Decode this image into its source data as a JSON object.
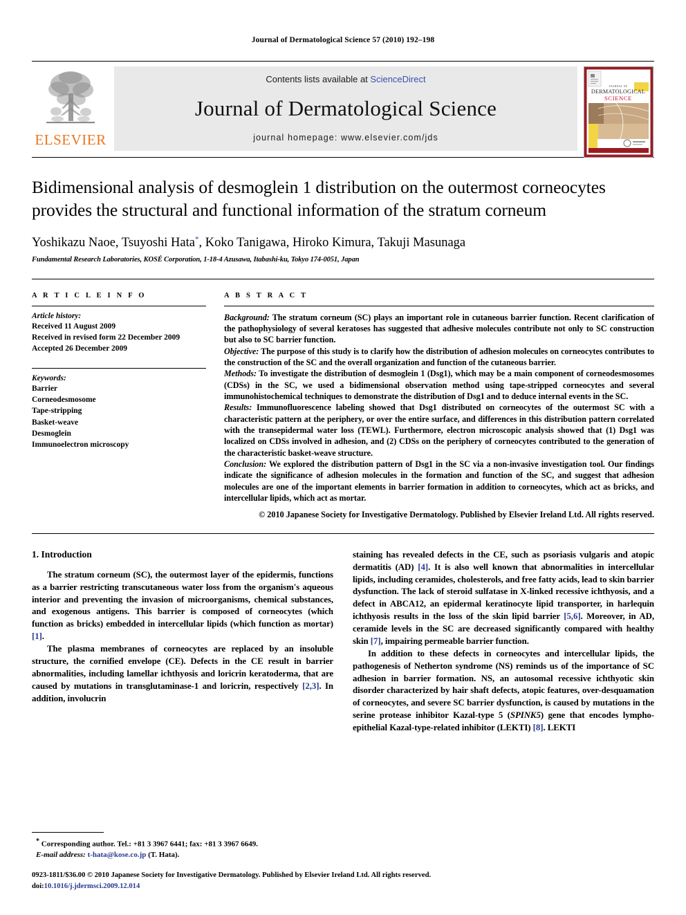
{
  "running_head": "Journal of Dermatological Science 57 (2010) 192–198",
  "masthead": {
    "logo_wordmark": "ELSEVIER",
    "contents_prefix": "Contents lists available at ",
    "sciencedirect": "ScienceDirect",
    "journal_title": "Journal of Dermatological Science",
    "homepage": "journal homepage: www.elsevier.com/jds",
    "cover": {
      "line1": "JOURNAL OF",
      "line2": "DERMATOLOGICAL",
      "line3": "SCIENCE",
      "border_color": "#9b1b23",
      "accent_color": "#c8102e",
      "band_yellow": "#f2d544",
      "skin_tone": "#c8a882"
    }
  },
  "article": {
    "title": "Bidimensional analysis of desmoglein 1 distribution on the outermost corneocytes provides the structural and functional information of the stratum corneum",
    "authors_pre": "Yoshikazu Naoe, Tsuyoshi Hata",
    "authors_star": "*",
    "authors_post": ", Koko Tanigawa, Hiroko Kimura, Takuji Masunaga",
    "affiliation": "Fundamental Research Laboratories, KOSÉ Corporation, 1-18-4 Azusawa, Itabashi-ku, Tokyo 174-0051, Japan"
  },
  "article_info": {
    "label": "A R T I C L E   I N F O",
    "history_head": "Article history:",
    "history": [
      "Received 11 August 2009",
      "Received in revised form 22 December 2009",
      "Accepted 26 December 2009"
    ],
    "keywords_head": "Keywords:",
    "keywords": [
      "Barrier",
      "Corneodesmosome",
      "Tape-stripping",
      "Basket-weave",
      "Desmoglein",
      "Immunoelectron microscopy"
    ]
  },
  "abstract": {
    "label": "A B S T R A C T",
    "sections": [
      {
        "lead": "Background:",
        "text": " The stratum corneum (SC) plays an important role in cutaneous barrier function. Recent clarification of the pathophysiology of several keratoses has suggested that adhesive molecules contribute not only to SC construction but also to SC barrier function."
      },
      {
        "lead": "Objective:",
        "text": " The purpose of this study is to clarify how the distribution of adhesion molecules on corneocytes contributes to the construction of the SC and the overall organization and function of the cutaneous barrier."
      },
      {
        "lead": "Methods:",
        "text": " To investigate the distribution of desmoglein 1 (Dsg1), which may be a main component of corneodesmosomes (CDSs) in the SC, we used a bidimensional observation method using tape-stripped corneocytes and several immunohistochemical techniques to demonstrate the distribution of Dsg1 and to deduce internal events in the SC."
      },
      {
        "lead": "Results:",
        "text": " Immunofluorescence labeling showed that Dsg1 distributed on corneocytes of the outermost SC with a characteristic pattern at the periphery, or over the entire surface, and differences in this distribution pattern correlated with the transepidermal water loss (TEWL). Furthermore, electron microscopic analysis showed that (1) Dsg1 was localized on CDSs involved in adhesion, and (2) CDSs on the periphery of corneocytes contributed to the generation of the characteristic basket-weave structure."
      },
      {
        "lead": "Conclusion:",
        "text": " We explored the distribution pattern of Dsg1 in the SC via a non-invasive investigation tool. Our findings indicate the significance of adhesion molecules in the formation and function of the SC, and suggest that adhesion molecules are one of the important elements in barrier formation in addition to corneocytes, which act as bricks, and intercellular lipids, which act as mortar."
      }
    ],
    "copyright": "© 2010 Japanese Society for Investigative Dermatology. Published by Elsevier Ireland Ltd. All rights reserved."
  },
  "body": {
    "section_heading": "1. Introduction",
    "left_paragraphs": [
      {
        "parts": [
          {
            "t": "The stratum corneum (SC), the outermost layer of the epidermis, functions as a barrier restricting transcutaneous water loss from the organism's aqueous interior and preventing the invasion of microorganisms, chemical substances, and exogenous antigens. This barrier is composed of corneocytes (which function as bricks) embedded in intercellular lipids (which function as mortar) "
          },
          {
            "t": "[1]",
            "style": "cite"
          },
          {
            "t": "."
          }
        ]
      },
      {
        "parts": [
          {
            "t": "The plasma membranes of corneocytes are replaced by an insoluble structure, the cornified envelope (CE). Defects in the CE result in barrier abnormalities, including lamellar ichthyosis and loricrin keratoderma, that are caused by mutations in transglutaminase-1 and loricrin, respectively "
          },
          {
            "t": "[2,3]",
            "style": "cite"
          },
          {
            "t": ". In addition, involucrin"
          }
        ]
      }
    ],
    "right_paragraphs": [
      {
        "noindent": true,
        "parts": [
          {
            "t": "staining has revealed defects in the CE, such as psoriasis vulgaris and atopic dermatitis (AD) "
          },
          {
            "t": "[4]",
            "style": "cite"
          },
          {
            "t": ". It is also well known that abnormalities in intercellular lipids, including ceramides, cholesterols, and free fatty acids, lead to skin barrier dysfunction. The lack of steroid sulfatase in X-linked recessive ichthyosis, and a defect in ABCA12, an epidermal keratinocyte lipid transporter, in harlequin ichthyosis results in the loss of the skin lipid barrier "
          },
          {
            "t": "[5,6]",
            "style": "cite"
          },
          {
            "t": ". Moreover, in AD, ceramide levels in the SC are decreased significantly compared with healthy skin "
          },
          {
            "t": "[7]",
            "style": "cite"
          },
          {
            "t": ", impairing permeable barrier function."
          }
        ]
      },
      {
        "parts": [
          {
            "t": "In addition to these defects in corneocytes and intercellular lipids, the pathogenesis of Netherton syndrome (NS) reminds us of the importance of SC adhesion in barrier formation. NS, an autosomal recessive ichthyotic skin disorder characterized by hair shaft defects, atopic features, over-desquamation of corneocytes, and severe SC barrier dysfunction, is caused by mutations in the serine protease inhibitor Kazal-type 5 ("
          },
          {
            "t": "SPINK5",
            "style": "ital"
          },
          {
            "t": ") gene that encodes lympho-epithelial Kazal-type-related inhibitor (LEKTI) "
          },
          {
            "t": "[8]",
            "style": "cite"
          },
          {
            "t": ". LEKTI"
          }
        ]
      }
    ]
  },
  "footnotes": {
    "corresponding": "Corresponding author. Tel.: +81 3 3967 6441; fax: +81 3 3967 6649.",
    "email_label": "E-mail address:",
    "email": "t-hata@kose.co.jp",
    "email_suffix": " (T. Hata)."
  },
  "footer": {
    "issn_line": "0923-1811/$36.00 © 2010 Japanese Society for Investigative Dermatology. Published by Elsevier Ireland Ltd. All rights reserved.",
    "doi_prefix": "doi:",
    "doi": "10.1016/j.jdermsci.2009.12.014"
  }
}
